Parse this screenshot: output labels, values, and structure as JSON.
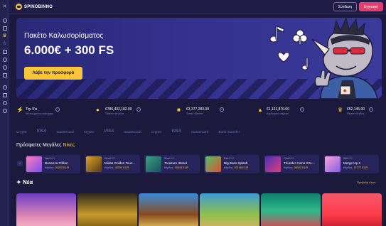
{
  "app": {
    "logo_text": "SPINOBINNO"
  },
  "header": {
    "login_label": "Σύνδεση",
    "register_label": "Εγγραφή"
  },
  "sidebar": {
    "icons": [
      "close-icon",
      "search-icon",
      "gift-icon",
      "crown-icon",
      "star-icon",
      "cards-icon",
      "chip-icon",
      "shield-icon",
      "dice-icon",
      "trophy-icon",
      "info-icon",
      "user-icon",
      "chat-icon"
    ]
  },
  "hero": {
    "subtitle": "Πακέτο Καλωσορίσματος",
    "title": "6.000€ + 300 FS",
    "cta_label": "Λάβε την προσφορά"
  },
  "stats": [
    {
      "value": "Την 5'α",
      "label": "Μέσος χρόνος ανάληψης"
    },
    {
      "value": "€786,432,182.00",
      "label": "Τζάκποτ σε μένα"
    },
    {
      "value": "€3,377,283.00",
      "label": "Τοπικό τζάκποτ"
    },
    {
      "value": "€1,121,870.00",
      "label": "Κερδισμένα σήμερα"
    },
    {
      "value": "€52,145.00",
      "label": "Μέγιστο κέρδος"
    }
  ],
  "payments": [
    "Crypto",
    "VISA",
    "mastercard",
    "Crypto",
    "VISA",
    "mastercard",
    "Crypto",
    "VISA",
    "mastercard",
    "Bank Transfer"
  ],
  "wins": {
    "title_prefix": "Πρόσφατες Μεγάλες",
    "title_highlight": "Νίκες",
    "amount_prefix": "Κέρδος:",
    "items": [
      {
        "user": "Vari*****",
        "game": "Bonanza Trillion",
        "amount": "20220 EUR"
      },
      {
        "user": "Kind*****",
        "game": "Midas Golden Touc...",
        "amount": "43790 EUR"
      },
      {
        "user": "Sha*****",
        "game": "Treasure Island",
        "amount": "75643 EUR"
      },
      {
        "user": "Eve*****",
        "game": "Big Bass Splash",
        "amount": "57108 EUR"
      },
      {
        "user": "Chui*****",
        "game": "Thunder Coins XXL...",
        "amount": "26022 EUR"
      },
      {
        "user": "Sid*****",
        "game": "Merge Up 2",
        "amount": "37777 EUR"
      }
    ]
  },
  "new_section": {
    "title": "Νέα",
    "more_label": "Προβολή όλων"
  },
  "colors": {
    "background": "#1b1a3d",
    "accent_yellow": "#f8c638",
    "accent_pink": "#e23d6e",
    "panel": "#26245a"
  }
}
